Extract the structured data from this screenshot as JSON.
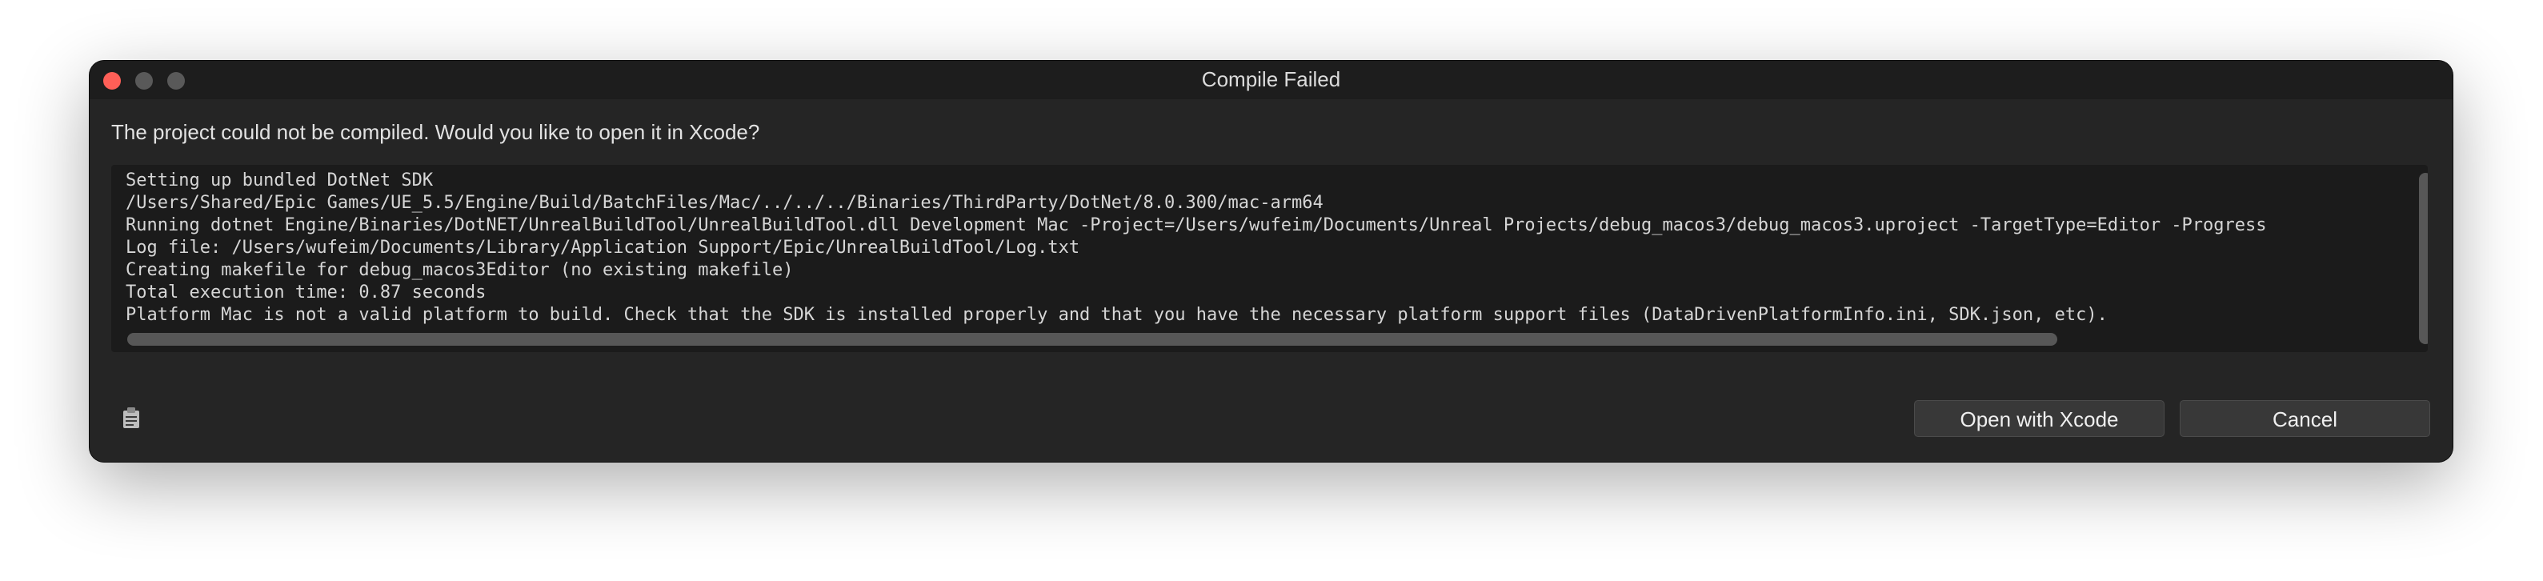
{
  "window": {
    "title": "Compile Failed"
  },
  "message": "The project could not be compiled. Would you like to open it in Xcode?",
  "log": {
    "lines": [
      "Setting up bundled DotNet SDK",
      "/Users/Shared/Epic Games/UE_5.5/Engine/Build/BatchFiles/Mac/../../../Binaries/ThirdParty/DotNet/8.0.300/mac-arm64",
      "Running dotnet Engine/Binaries/DotNET/UnrealBuildTool/UnrealBuildTool.dll Development Mac -Project=/Users/wufeim/Documents/Unreal Projects/debug_macos3/debug_macos3.uproject -TargetType=Editor -Progress",
      "Log file: /Users/wufeim/Documents/Library/Application Support/Epic/UnrealBuildTool/Log.txt",
      "Creating makefile for debug_macos3Editor (no existing makefile)",
      "Total execution time: 0.87 seconds",
      "Platform Mac is not a valid platform to build. Check that the SDK is installed properly and that you have the necessary platform support files (DataDrivenPlatformInfo.ini, SDK.json, etc)."
    ]
  },
  "buttons": {
    "open_xcode": "Open with Xcode",
    "cancel": "Cancel"
  },
  "icons": {
    "close": "close-window-icon",
    "minimize": "minimize-window-icon",
    "maximize": "maximize-window-icon",
    "copy": "clipboard-icon"
  },
  "colors": {
    "close_button": "#fe5f57",
    "dialog_background": "#252525",
    "log_background": "#1b1b1b"
  }
}
